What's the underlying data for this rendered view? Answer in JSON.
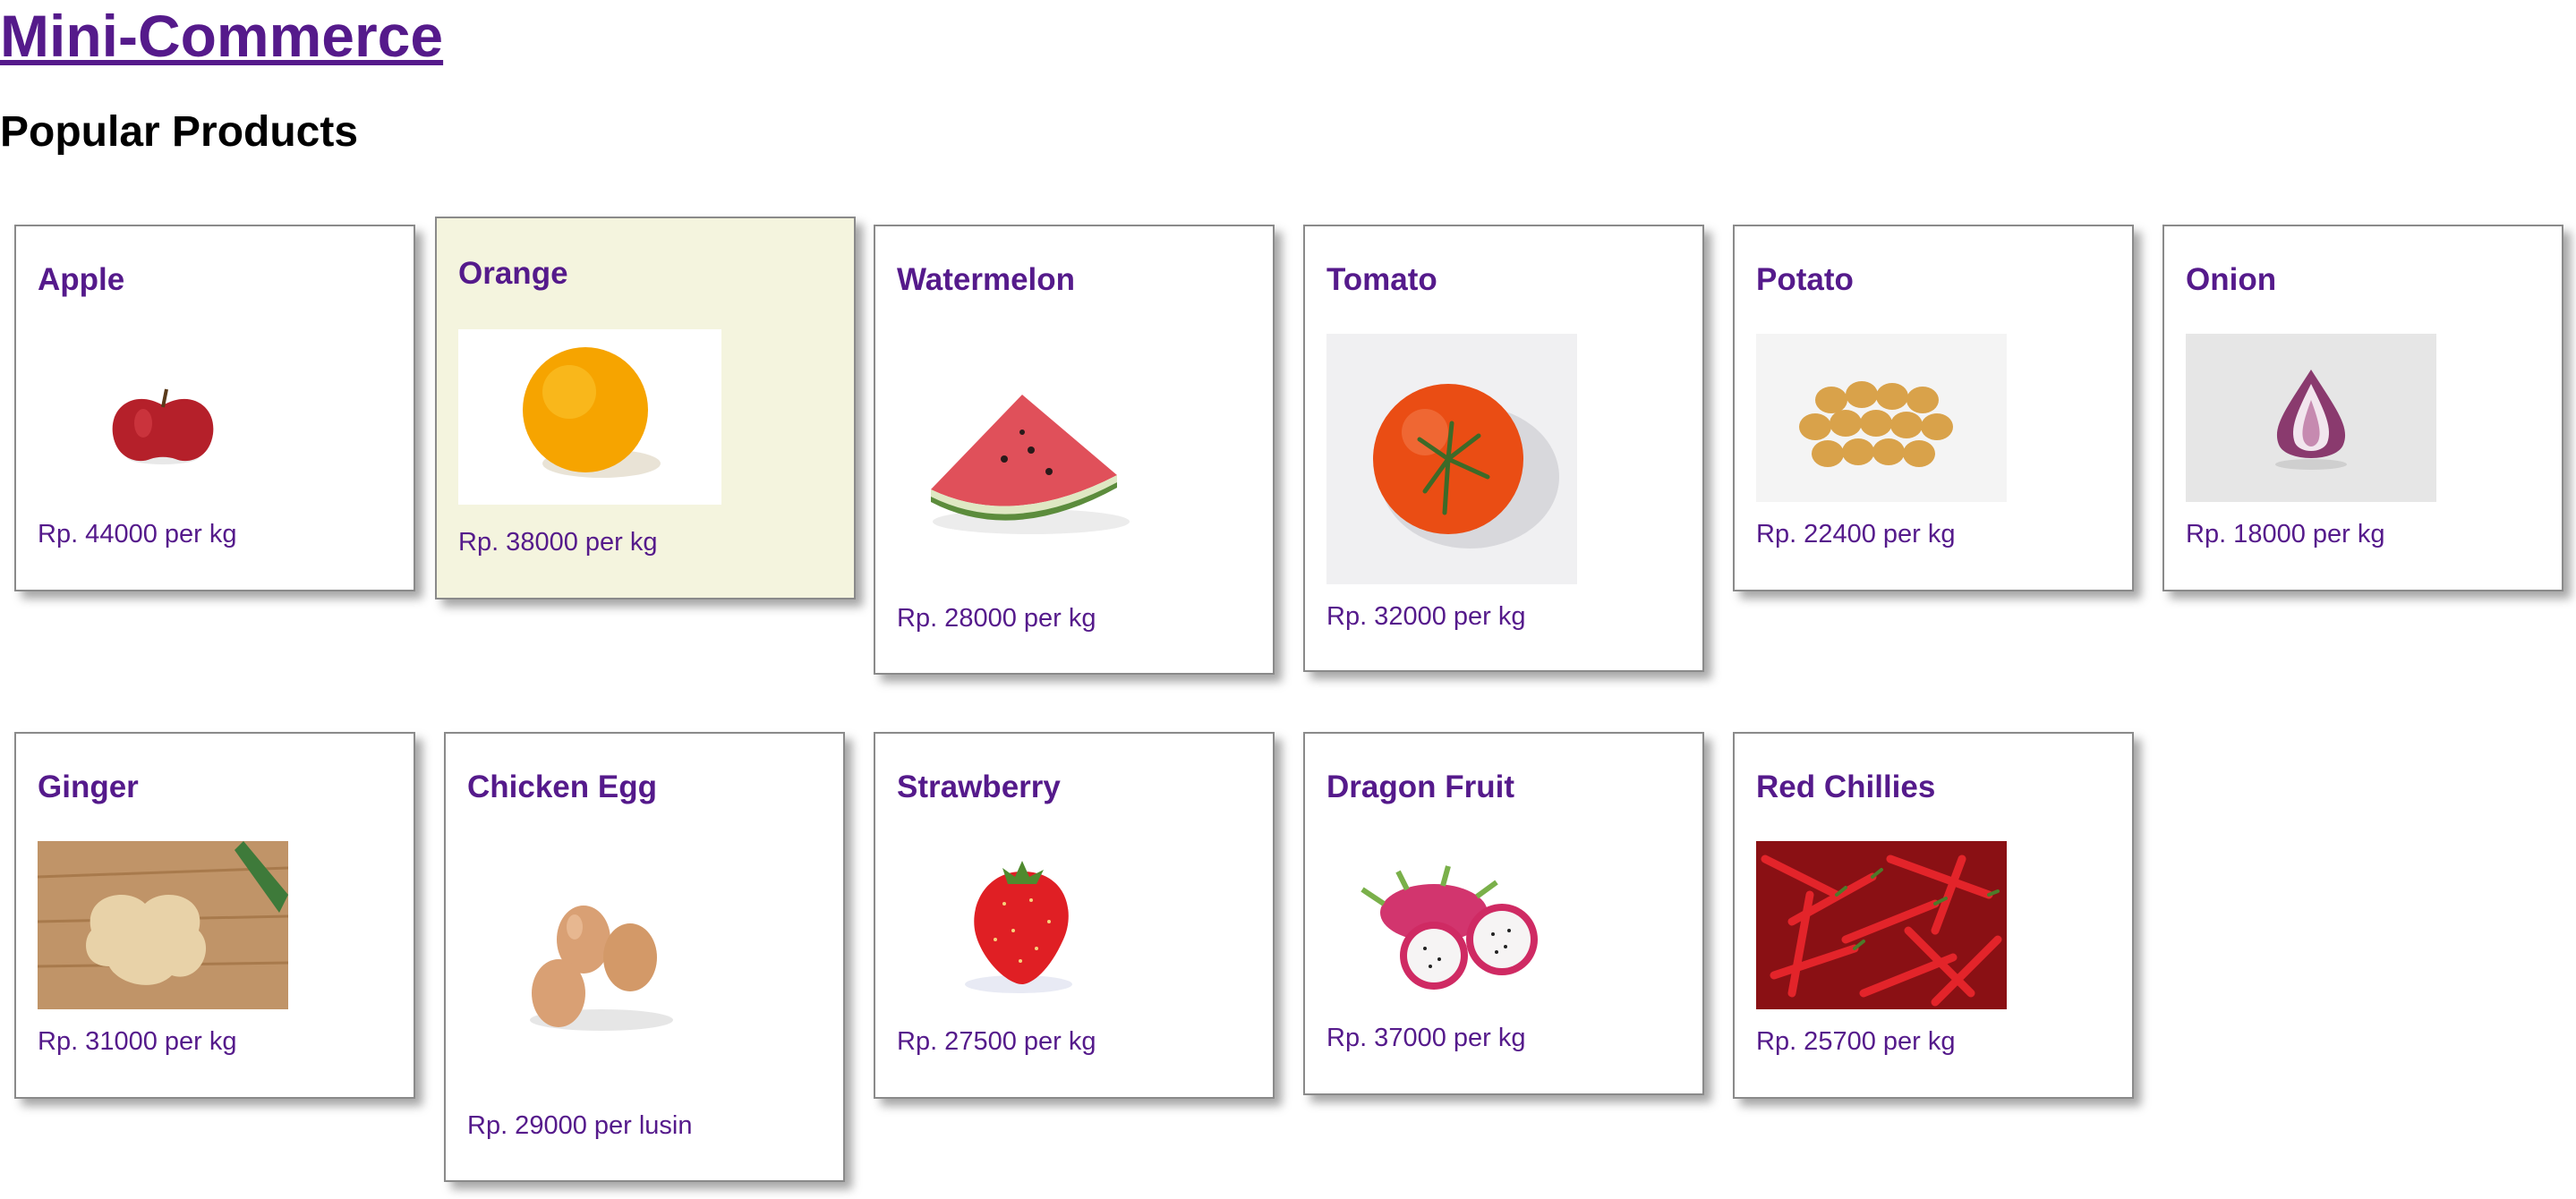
{
  "site": {
    "title": "Mini-Commerce"
  },
  "section": {
    "title": "Popular Products"
  },
  "products": [
    {
      "name": "Apple",
      "price": "Rp. 44000 per kg"
    },
    {
      "name": "Orange",
      "price": "Rp. 38000 per kg"
    },
    {
      "name": "Watermelon",
      "price": "Rp. 28000 per kg"
    },
    {
      "name": "Tomato",
      "price": "Rp. 32000 per kg"
    },
    {
      "name": "Potato",
      "price": "Rp. 22400 per kg"
    },
    {
      "name": "Onion",
      "price": "Rp. 18000 per kg"
    },
    {
      "name": "Ginger",
      "price": "Rp. 31000 per kg"
    },
    {
      "name": "Chicken Egg",
      "price": "Rp. 29000 per lusin"
    },
    {
      "name": "Strawberry",
      "price": "Rp. 27500 per kg"
    },
    {
      "name": "Dragon Fruit",
      "price": "Rp. 37000 per kg"
    },
    {
      "name": "Red Chillies",
      "price": "Rp. 25700 per kg"
    }
  ],
  "colors": {
    "link": "#551a8b",
    "highlight_card": "#f4f4de",
    "card_border": "#8a8a8a"
  }
}
